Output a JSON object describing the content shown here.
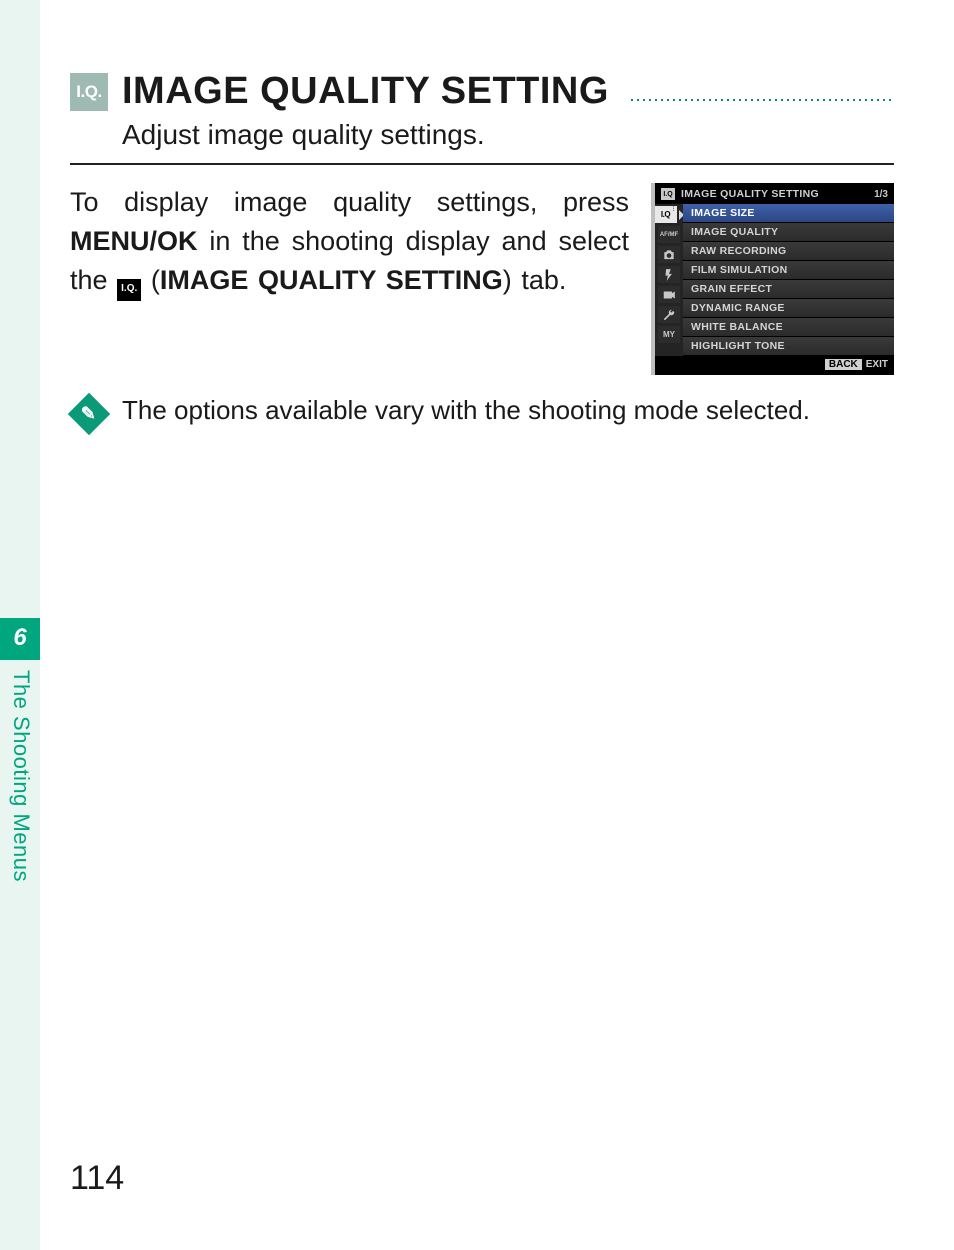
{
  "heading": {
    "icon_label": "I.Q.",
    "title": "IMAGE QUALITY SETTING",
    "subtitle": "Adjust image quality settings."
  },
  "body": {
    "pre": "To display image quality settings, press ",
    "menu_ok": "MENU/OK",
    "mid": " in the shooting display and select the ",
    "inline_icon": "I.Q.",
    "post1": " (",
    "tab_name": "IMAGE QUALITY SETTING",
    "post2": ") tab."
  },
  "menu": {
    "header_icon": "I.Q",
    "header_title": "IMAGE QUALITY SETTING",
    "header_page": "1/3",
    "tabs": [
      "I.Q",
      "AF/MF",
      "cam",
      "flash",
      "movie",
      "wrench",
      "MY"
    ],
    "items": [
      "IMAGE SIZE",
      "IMAGE QUALITY",
      "RAW RECORDING",
      "FILM SIMULATION",
      "GRAIN EFFECT",
      "DYNAMIC RANGE",
      "WHITE BALANCE",
      "HIGHLIGHT TONE"
    ],
    "selected_index": 0,
    "back": "BACK",
    "exit": "EXIT"
  },
  "note": {
    "text": "The options available vary with the shooting mode selected."
  },
  "chapter": {
    "number": "6",
    "label": "The Shooting Menus"
  },
  "page_number": "114"
}
